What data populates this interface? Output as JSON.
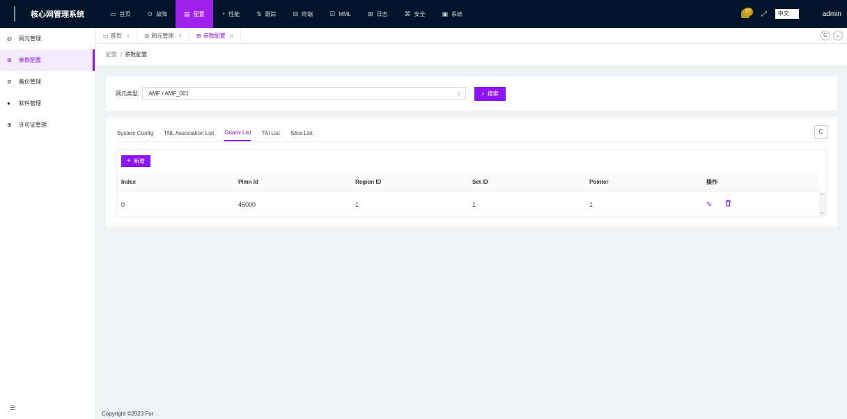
{
  "app": {
    "title": "核心网管理系统"
  },
  "topnav": {
    "items": [
      {
        "icon": "▭",
        "label": "首页",
        "active": false
      },
      {
        "icon": "⊙",
        "label": "故障",
        "active": false
      },
      {
        "icon": "▤",
        "label": "配置",
        "active": true
      },
      {
        "icon": "◔",
        "label": "性能",
        "active": false
      },
      {
        "icon": "⇅",
        "label": "跟踪",
        "active": false
      },
      {
        "icon": "⊟",
        "label": "终端",
        "active": false
      },
      {
        "icon": "☑",
        "label": "MML",
        "active": false
      },
      {
        "icon": "⊞",
        "label": "日志",
        "active": false
      },
      {
        "icon": "⌘",
        "label": "安全",
        "active": false
      },
      {
        "icon": "▣",
        "label": "系统",
        "active": false
      }
    ],
    "badge_count": "17",
    "fullscreen_icon": "⤢",
    "language": "中文",
    "user": "admin"
  },
  "sidebar": {
    "items": [
      {
        "icon": "◎",
        "label": "网元管理",
        "active": false
      },
      {
        "icon": "⊞",
        "label": "参数配置",
        "active": true
      },
      {
        "icon": "⊘",
        "label": "备份管理",
        "active": false
      },
      {
        "icon": "●",
        "label": "软件管理",
        "active": false
      },
      {
        "icon": "⊕",
        "label": "许可证管理",
        "active": false
      }
    ],
    "collapse_icon": "☰"
  },
  "page_tabs": [
    {
      "icon": "▭",
      "label": "首页",
      "close": "×",
      "active": false
    },
    {
      "icon": "◎",
      "label": "网元管理",
      "close": "×",
      "active": false
    },
    {
      "icon": "⊞",
      "label": "参数配置",
      "close": "×",
      "active": true
    }
  ],
  "tab_actions": {
    "reload": "C",
    "more": "⌄"
  },
  "breadcrumb": {
    "parent": "配置",
    "sep": "/",
    "current": "参数配置"
  },
  "search": {
    "label": "网元类型:",
    "value": "AMF / AMF_001",
    "chevron": "∨",
    "button_icon": "⌕",
    "button_label": "搜索"
  },
  "config_tabs": [
    {
      "label": "System Config",
      "active": false
    },
    {
      "label": "TNL Association List",
      "active": false
    },
    {
      "label": "Guami List",
      "active": true
    },
    {
      "label": "TAI List",
      "active": false
    },
    {
      "label": "Slice List",
      "active": false
    }
  ],
  "refresh_icon": "C",
  "add_button": {
    "icon": "+",
    "label": "新增"
  },
  "table": {
    "headers": [
      "Index",
      "Plmn Id",
      "Region ID",
      "Set ID",
      "Pointer",
      "操作"
    ],
    "rows": [
      {
        "index": "0",
        "plmn": "46000",
        "region": "1",
        "set": "1",
        "pointer": "1",
        "edit_icon": "✎",
        "delete_icon": "🗑"
      }
    ]
  },
  "footer": "Copyright ©2023 For"
}
